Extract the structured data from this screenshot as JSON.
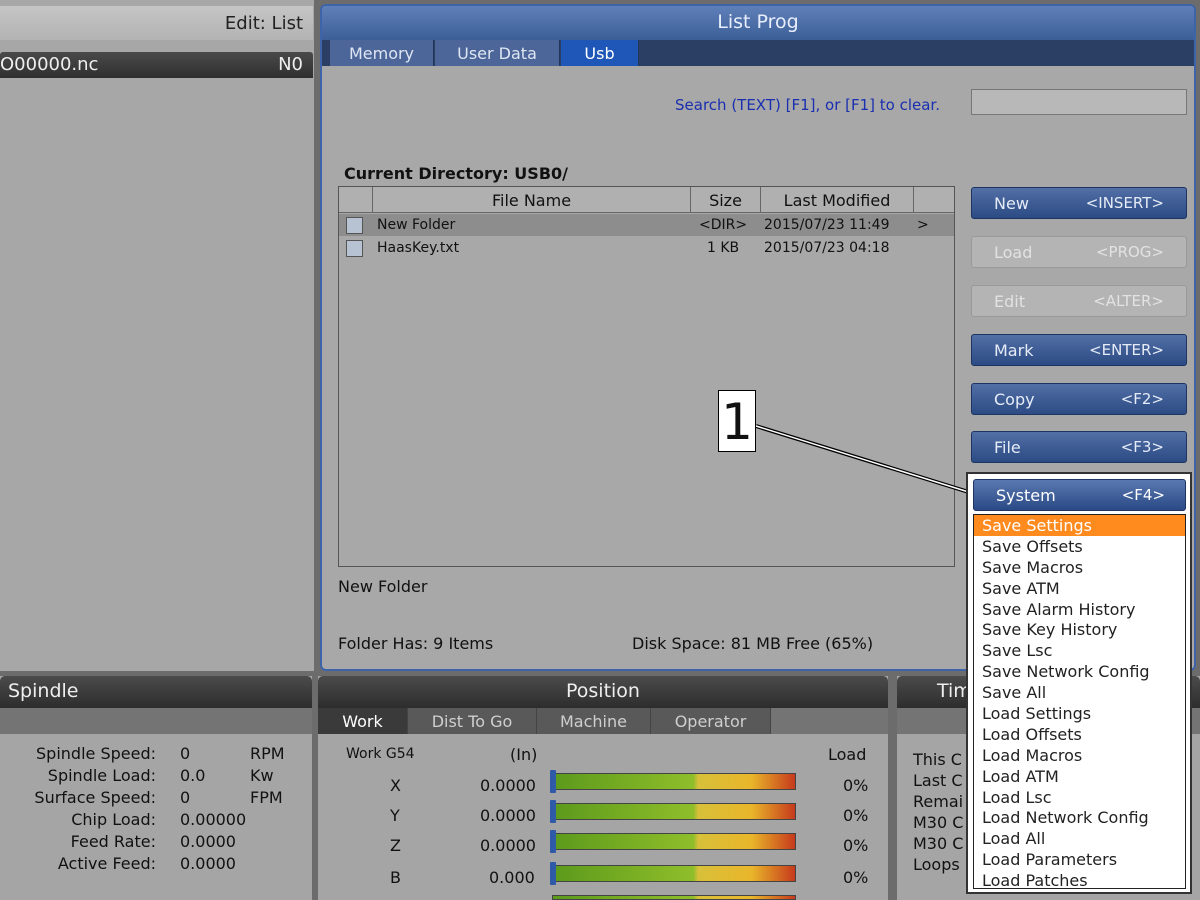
{
  "editor": {
    "title": "Edit: List",
    "program_name": "O00000.nc",
    "program_num": "N0"
  },
  "list_prog": {
    "title": "List Prog",
    "tabs": [
      "Memory",
      "User Data",
      "Usb"
    ],
    "active_tab": "Usb",
    "search_hint": "Search (TEXT) [F1], or [F1] to clear.",
    "current_directory": "Current Directory: USB0/",
    "columns": [
      "File Name",
      "Size",
      "Last Modified"
    ],
    "files": [
      {
        "name": "New Folder",
        "size": "<DIR>",
        "modified": "2015/07/23 11:49",
        "extra": ">"
      },
      {
        "name": "HaasKey.txt",
        "size": "1 KB",
        "modified": "2015/07/23 04:18",
        "extra": ""
      }
    ],
    "selected_name": "New Folder",
    "folder_has": "Folder Has: 9 Items",
    "disk_space": "Disk Space: 81 MB Free (65%)"
  },
  "side_buttons": [
    {
      "label": "New",
      "key": "<INSERT>",
      "enabled": true
    },
    {
      "label": "Load",
      "key": "<PROG>",
      "enabled": false
    },
    {
      "label": "Edit",
      "key": "<ALTER>",
      "enabled": false
    },
    {
      "label": "Mark",
      "key": "<ENTER>",
      "enabled": true
    },
    {
      "label": "Copy",
      "key": "<F2>",
      "enabled": true
    },
    {
      "label": "File",
      "key": "<F3>",
      "enabled": true
    }
  ],
  "system_menu": {
    "label": "System",
    "key": "<F4>",
    "items": [
      "Save Settings",
      "Save Offsets",
      "Save Macros",
      "Save ATM",
      "Save Alarm History",
      "Save Key History",
      "Save Lsc",
      "Save Network Config",
      "Save All",
      "Load Settings",
      "Load Offsets",
      "Load Macros",
      "Load ATM",
      "Load Lsc",
      "Load Network Config",
      "Load All",
      "Load Parameters",
      "Load Patches"
    ],
    "highlighted": "Save Settings"
  },
  "callout_label": "1",
  "spindle": {
    "title": "Spindle",
    "rows": [
      {
        "label": "Spindle Speed:",
        "value": "0",
        "unit": "RPM"
      },
      {
        "label": "Spindle Load:",
        "value": "0.0",
        "unit": "Kw"
      },
      {
        "label": "Surface Speed:",
        "value": "0",
        "unit": "FPM"
      },
      {
        "label": "Chip Load:",
        "value": "0.00000",
        "unit": ""
      },
      {
        "label": "Feed Rate:",
        "value": "0.0000",
        "unit": ""
      },
      {
        "label": "Active Feed:",
        "value": "0.0000",
        "unit": ""
      }
    ]
  },
  "position": {
    "title": "Position",
    "tabs": [
      "Work",
      "Dist To Go",
      "Machine",
      "Operator"
    ],
    "active_tab": "Work",
    "coord_label": "Work G54",
    "unit_label": "(In)",
    "load_label": "Load",
    "axes": [
      {
        "axis": "X",
        "value": "0.0000",
        "load": "0%"
      },
      {
        "axis": "Y",
        "value": "0.0000",
        "load": "0%"
      },
      {
        "axis": "Z",
        "value": "0.0000",
        "load": "0%"
      },
      {
        "axis": "B",
        "value": "0.000",
        "load": "0%"
      }
    ]
  },
  "timers": {
    "title_partial": "Tim",
    "rows": [
      "This C",
      "Last C",
      "Remai",
      "M30 C",
      "M30 C",
      "Loops"
    ]
  }
}
